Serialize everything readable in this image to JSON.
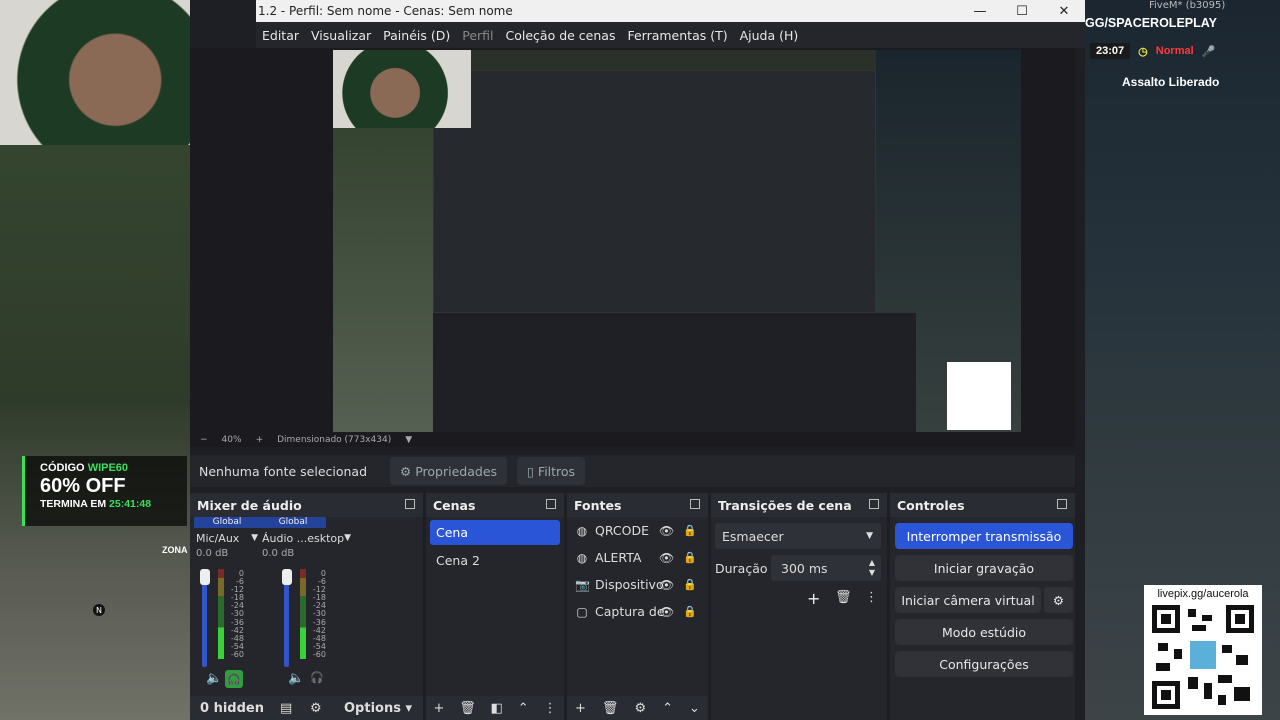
{
  "window": {
    "title": "1.2 - Perfil: Sem nome - Cenas: Sem nome"
  },
  "menu": {
    "items": [
      "Editar",
      "Visualizar",
      "Painéis (D)",
      "Perfil",
      "Coleção de cenas",
      "Ferramentas (T)",
      "Ajuda (H)"
    ]
  },
  "preview": {
    "zoom": "40%",
    "size": "Dimensionado (773x434)"
  },
  "source_bar": {
    "label": "Nenhuma fonte selecionad",
    "properties": "Propriedades",
    "filters": "Filtros"
  },
  "mixer": {
    "title": "Mixer de áudio",
    "channels": [
      {
        "head": "Global",
        "name": "Mic/Aux",
        "db": "0.0 dB"
      },
      {
        "head": "Global",
        "name": "Áudio ...esktop",
        "db": "0.0 dB"
      }
    ],
    "scale": [
      "0",
      "-6",
      "-12",
      "-18",
      "-24",
      "-30",
      "-36",
      "-42",
      "-48",
      "-54",
      "-60"
    ],
    "hidden": "0 hidden",
    "options": "Options"
  },
  "scenes": {
    "title": "Cenas",
    "items": [
      "Cena",
      "Cena 2"
    ]
  },
  "sources": {
    "title": "Fontes",
    "items": [
      "QRCODE",
      "ALERTA",
      "Dispositivo",
      "Captura de"
    ]
  },
  "transitions": {
    "title": "Transições de cena",
    "selected": "Esmaecer",
    "duration_label": "Duração",
    "duration_value": "300 ms"
  },
  "controls": {
    "title": "Controles",
    "stop_stream": "Interromper transmissão",
    "start_recording": "Iniciar gravação",
    "virtual_cam": "Iniciar câmera virtual",
    "studio_mode": "Modo estúdio",
    "settings": "Configurações"
  },
  "overlay": {
    "server": "GG/SPACEROLEPLAY",
    "time": "23:07",
    "mode": "Normal",
    "event": "Assalto Liberado",
    "fivem": "FiveM* (b3095)",
    "qr_url": "livepix.gg/aucerola",
    "promo_code_label": "CÓDIGO",
    "promo_code": "WIPE60",
    "promo_off": "60% OFF",
    "promo_ends_label": "TERMINA EM",
    "promo_ends": "25:41:48",
    "zona": "ZONA",
    "compass": "N"
  },
  "colors": {
    "accent": "#2a55d6",
    "promo": "#3ae05a",
    "alert": "#ff3b3b"
  }
}
